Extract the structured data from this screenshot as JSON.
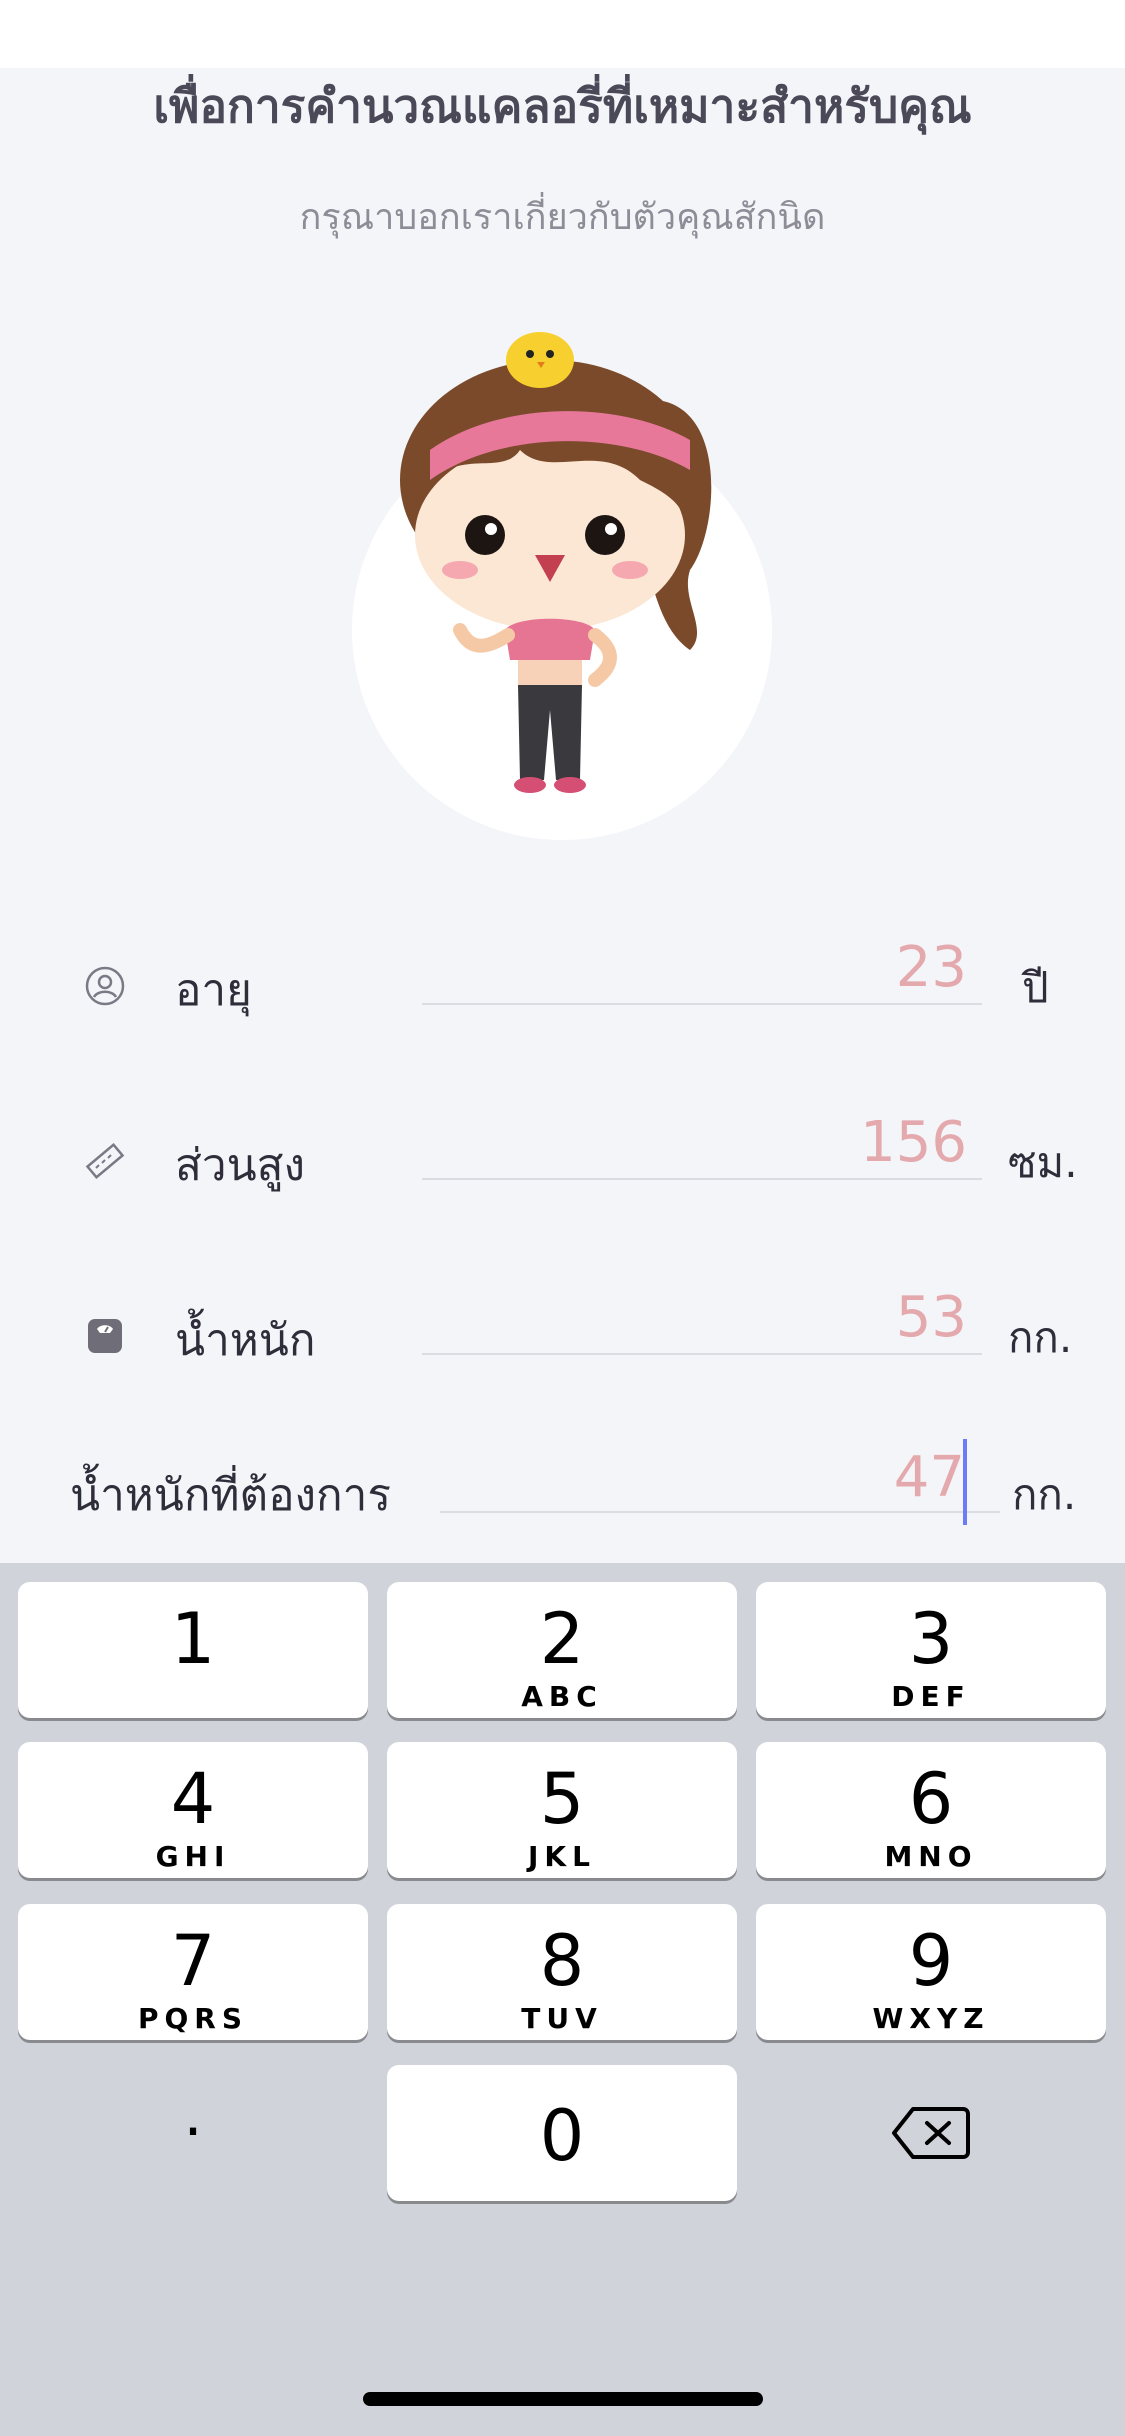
{
  "header": {
    "title": "เพื่อการคำนวณแคลอรี่ที่เหมาะสำหรับคุณ",
    "subtitle": "กรุณาบอกเราเกี่ยวกับตัวคุณสักนิด"
  },
  "form": {
    "age": {
      "label": "อายุ",
      "value": "23",
      "unit": "ปี",
      "icon": "user-circle-icon"
    },
    "height": {
      "label": "ส่วนสูง",
      "value": "156",
      "unit": "ซม.",
      "icon": "ruler-icon"
    },
    "weight": {
      "label": "น้ำหนัก",
      "value": "53",
      "unit": "กก.",
      "icon": "scale-icon"
    },
    "target_weight": {
      "label": "น้ำหนักที่ต้องการ",
      "value": "47",
      "unit": "กก."
    }
  },
  "keyboard": {
    "keys": [
      {
        "num": "1",
        "letters": ""
      },
      {
        "num": "2",
        "letters": "ABC"
      },
      {
        "num": "3",
        "letters": "DEF"
      },
      {
        "num": "4",
        "letters": "GHI"
      },
      {
        "num": "5",
        "letters": "JKL"
      },
      {
        "num": "6",
        "letters": "MNO"
      },
      {
        "num": "7",
        "letters": "PQRS"
      },
      {
        "num": "8",
        "letters": "TUV"
      },
      {
        "num": "9",
        "letters": "WXYZ"
      },
      {
        "num": "0",
        "letters": ""
      }
    ],
    "dot": ".",
    "backspace_icon": "backspace-icon"
  },
  "colors": {
    "background": "#f4f5f9",
    "value_text": "#e3a9ad",
    "caret": "#6c7cf5",
    "keyboard_bg": "#d1d3db"
  }
}
